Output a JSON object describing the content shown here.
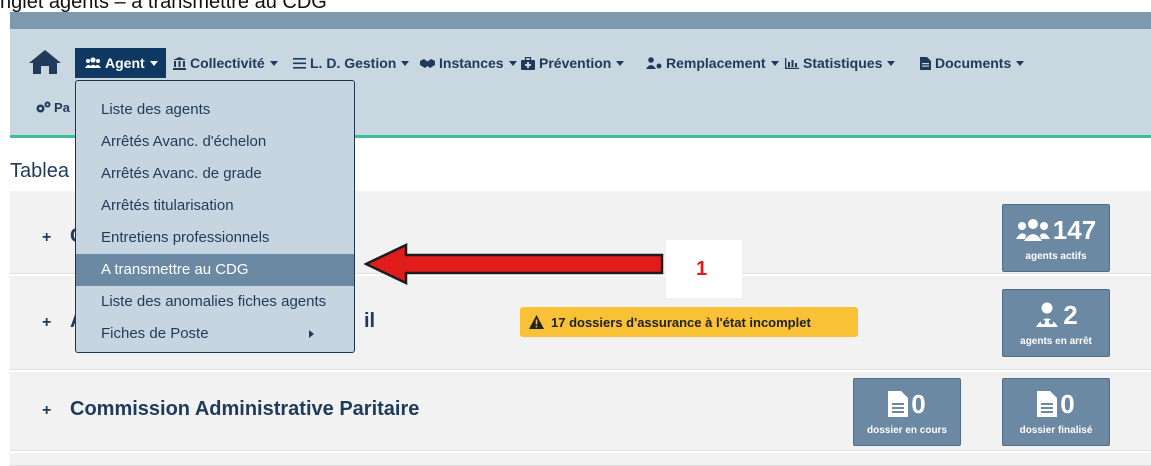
{
  "caption": "nglet agents – a transmettre au CDG",
  "colors": {
    "navbar": "#c9d7e1",
    "active_nav": "#0f3963",
    "accent_line": "#3dbf9a",
    "stat_box": "#6b89a3",
    "alert": "#f8c136",
    "arrow": "#e21b1b"
  },
  "nav": {
    "home_icon": "home-icon",
    "items": [
      {
        "label": "Agent",
        "icon": "users-icon"
      },
      {
        "label": "Collectivité",
        "icon": "institution-icon"
      },
      {
        "label": "L. D. Gestion",
        "icon": "list-icon"
      },
      {
        "label": "Instances",
        "icon": "handshake-icon"
      },
      {
        "label": "Prévention",
        "icon": "medkit-icon"
      },
      {
        "label": "Remplacement",
        "icon": "user-swap-icon"
      },
      {
        "label": "Statistiques",
        "icon": "bar-chart-icon"
      },
      {
        "label": "Documents",
        "icon": "document-icon"
      }
    ],
    "param_label": "Pa",
    "param_icon": "gears-icon"
  },
  "dropdown": {
    "items": [
      {
        "label": "Liste des agents"
      },
      {
        "label": "Arrêtés Avanc. d'échelon"
      },
      {
        "label": "Arrêtés Avanc. de grade"
      },
      {
        "label": "Arrêtés titularisation"
      },
      {
        "label": "Entretiens professionnels"
      },
      {
        "label": "A transmettre au CDG",
        "active": true
      },
      {
        "label": "Liste des anomalies fiches agents"
      },
      {
        "label": "Fiches de Poste",
        "submenu": true
      }
    ]
  },
  "main": {
    "heading": "Tablea",
    "cards": [
      {
        "plus": "+",
        "peek_text": "C",
        "stats": [
          {
            "value": "147",
            "label": "agents actifs",
            "icon": "users-icon"
          }
        ]
      },
      {
        "plus": "+",
        "peek_left": "A",
        "peek_right": "il",
        "stats": [
          {
            "value": "2",
            "label": "agents en arrêt",
            "icon": "user-medical-icon"
          }
        ]
      },
      {
        "plus": "+",
        "title": "Commission Administrative Paritaire",
        "stats": [
          {
            "value": "0",
            "label": "dossier en cours",
            "icon": "file-icon"
          },
          {
            "value": "0",
            "label": "dossier finalisé",
            "icon": "file-icon"
          }
        ]
      }
    ],
    "alert": {
      "text": "17 dossiers d'assurance à l'état incomplet",
      "icon": "warning-icon"
    }
  },
  "annotation": {
    "number": "1"
  }
}
